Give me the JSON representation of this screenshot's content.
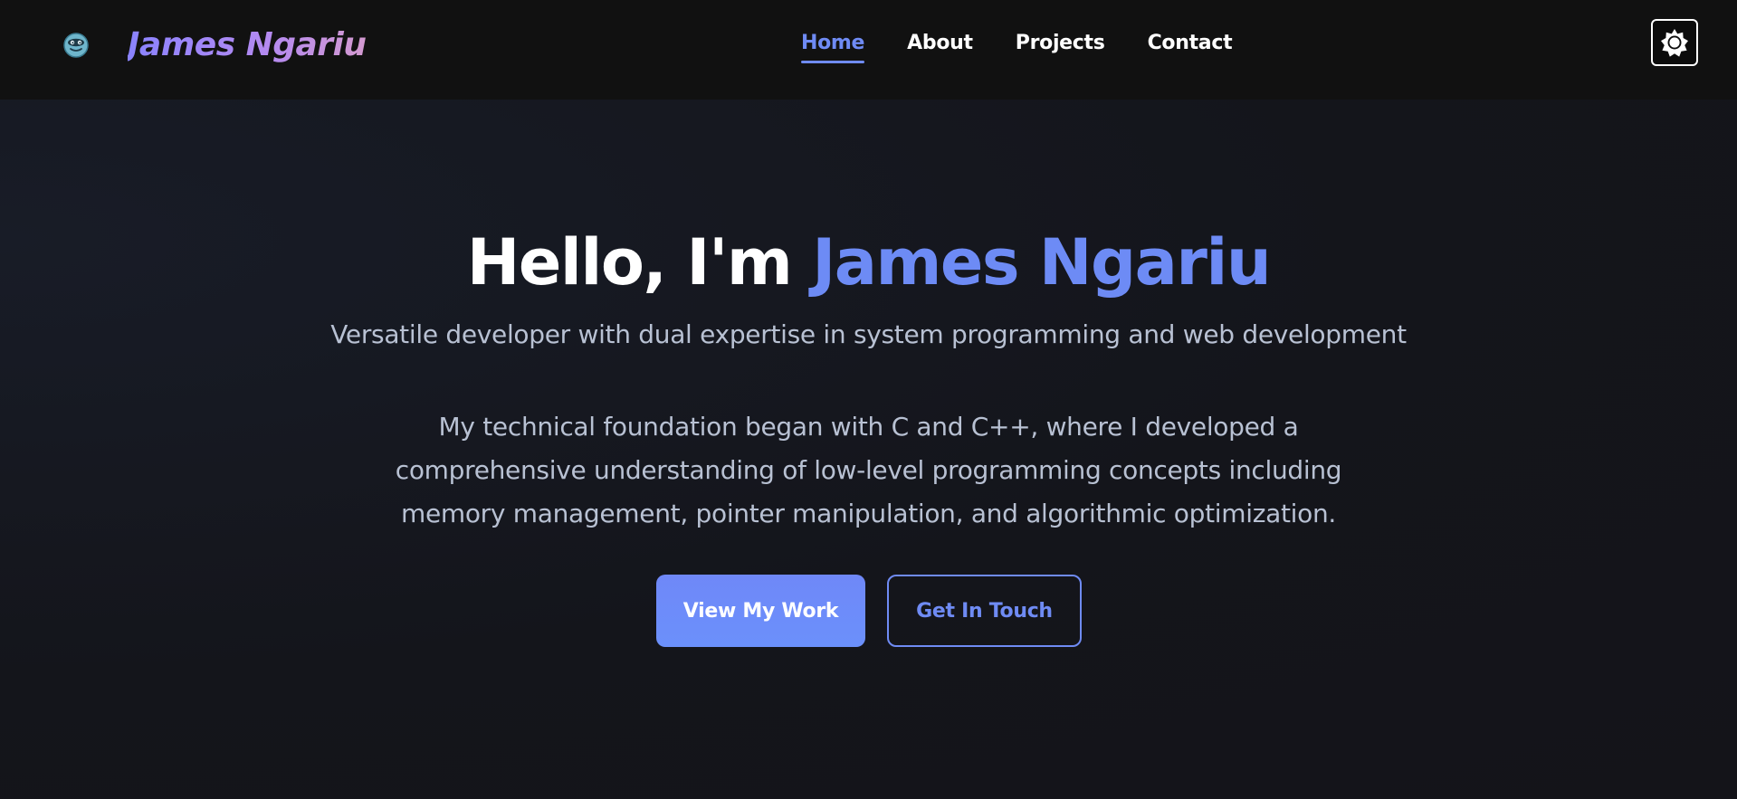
{
  "navbar": {
    "brand_name": "James Ngariu",
    "logo_icon": "cartoon-face-icon",
    "links": [
      {
        "label": "Home",
        "active": true
      },
      {
        "label": "About",
        "active": false
      },
      {
        "label": "Projects",
        "active": false
      },
      {
        "label": "Contact",
        "active": false
      }
    ],
    "theme_toggle_icon": "sun-icon"
  },
  "hero": {
    "greeting": "Hello, I'm ",
    "name": "James Ngariu",
    "subtitle": "Versatile developer with dual expertise in system programming and web development",
    "paragraph": "My technical foundation began with C and C++, where I developed a comprehensive understanding of low-level programming concepts including memory management, pointer manipulation, and algorithmic optimization.",
    "primary_button": "View My Work",
    "secondary_button": "Get In Touch"
  },
  "colors": {
    "background": "#14151b",
    "navbar": "#111111",
    "accent": "#6d8bf5",
    "text_muted": "#b8c1d3",
    "brand_gradient_start": "#8a83ff",
    "brand_gradient_end": "#d49ad0"
  }
}
